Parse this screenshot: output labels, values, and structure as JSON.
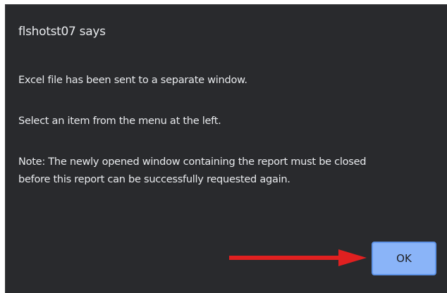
{
  "dialog": {
    "title": "flshotst07 says",
    "message_line1": "Excel file has been sent to a separate window.",
    "message_line2": "Select an item from the menu at the left.",
    "message_line3a": "Note: The newly opened window containing the report must be closed",
    "message_line3b": "before this report can be successfully requested again.",
    "ok_label": "OK"
  },
  "annotation": {
    "arrow_icon": "right-arrow-icon",
    "arrow_color": "#e02020"
  },
  "colors": {
    "dialog_bg": "#292a2d",
    "text": "#e8eaed",
    "button_bg": "#8ab4f8"
  }
}
